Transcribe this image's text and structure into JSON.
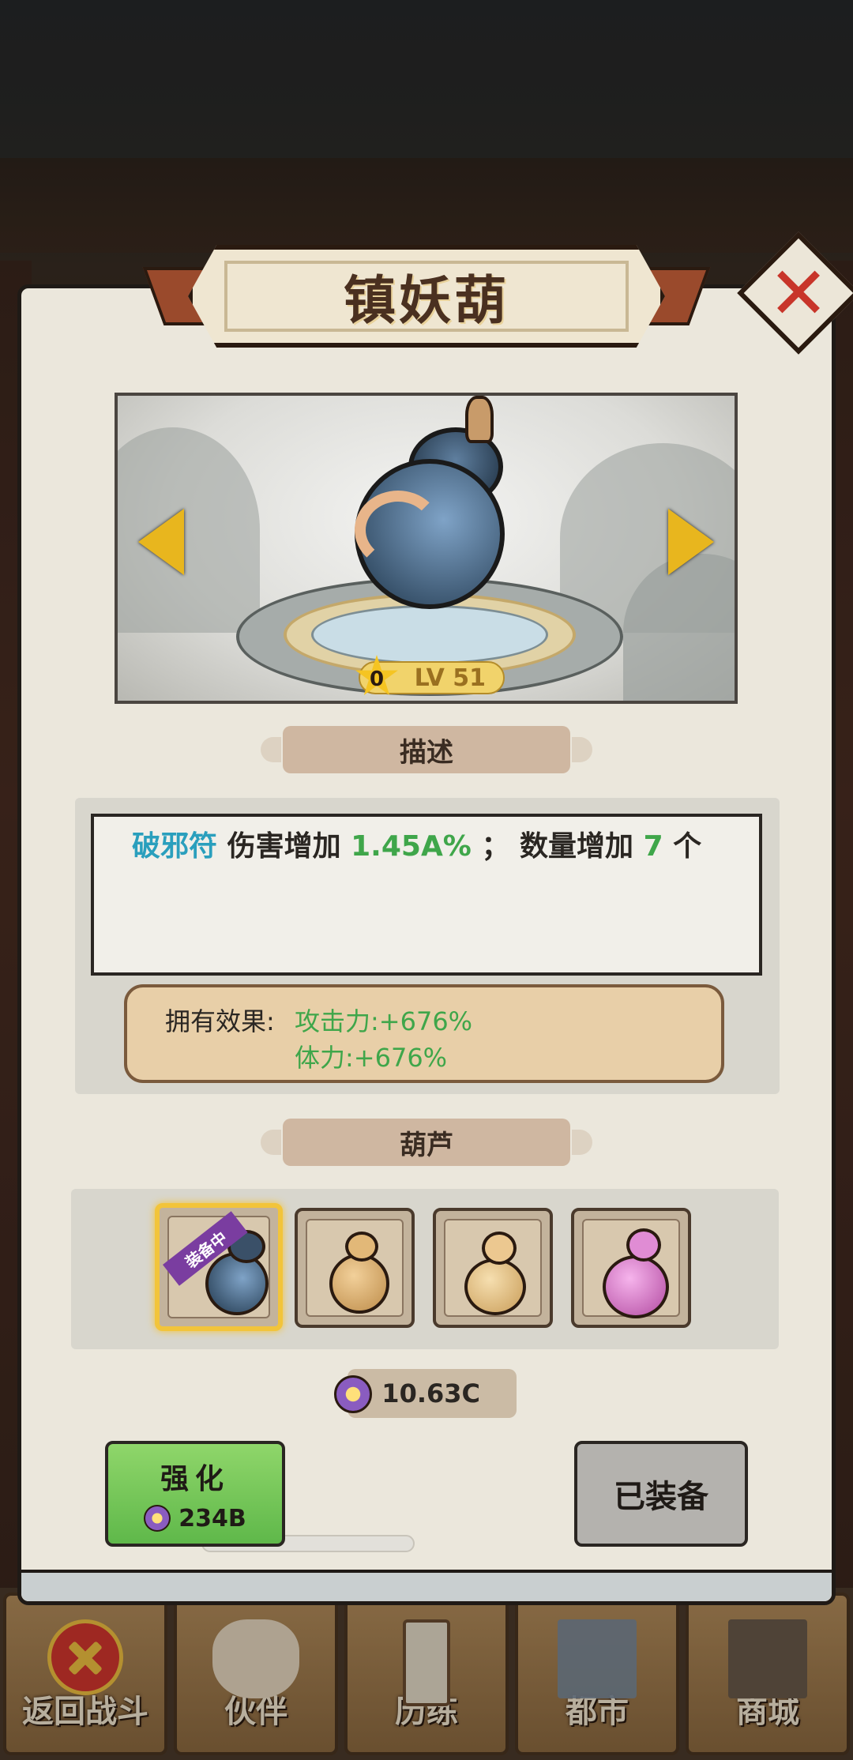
{
  "title": "镇妖葫",
  "item": {
    "star": "0",
    "level": "LV 51"
  },
  "sections": {
    "description_header": "描述",
    "gourd_header": "葫芦"
  },
  "description": {
    "keyword": "破邪符",
    "part1": "伤害增加",
    "value1": "1.45A%",
    "sep": "；",
    "part2": "数量增加",
    "value2": "7",
    "unit": "个"
  },
  "effect": {
    "label": "拥有效果:",
    "attack": "攻击力:+676%",
    "stamina": "体力:+676%"
  },
  "slots": {
    "equipped_tag": "装备中"
  },
  "currency": {
    "amount": "10.63C"
  },
  "buttons": {
    "upgrade_label": "强化",
    "upgrade_cost": "234B",
    "equipped_label": "已装备"
  },
  "bottom_nav": {
    "back": "返回战斗",
    "partner": "伙伴",
    "training": "历练",
    "city": "都市",
    "shop": "商城"
  },
  "colors": {
    "keyword_teal": "#2a9fbd",
    "value_green": "#3fa64a",
    "upgrade_green": "#5fb84a",
    "level_gold": "#f1d36b"
  }
}
